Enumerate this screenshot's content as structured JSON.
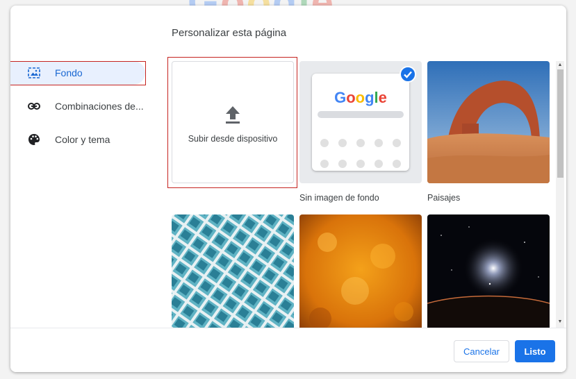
{
  "background_logo": "Google",
  "dialog": {
    "title": "Personalizar esta página",
    "nav": [
      {
        "label": "Fondo",
        "icon": "wallpaper-icon",
        "active": true
      },
      {
        "label": "Combinaciones de...",
        "icon": "link-icon",
        "active": false
      },
      {
        "label": "Color y tema",
        "icon": "palette-icon",
        "active": false
      }
    ],
    "tiles": {
      "upload": {
        "label": "Subir desde dispositivo",
        "icon": "upload-icon"
      },
      "no_image": {
        "label": "Sin imagen de fondo",
        "logo": "Google",
        "selected": true
      },
      "landscapes": {
        "label": "Paisajes"
      }
    },
    "buttons": {
      "cancel": "Cancelar",
      "done": "Listo"
    }
  },
  "colors": {
    "accent": "#1a73e8",
    "highlight": "#c5221f",
    "active_nav_bg": "#e8f0fe"
  }
}
